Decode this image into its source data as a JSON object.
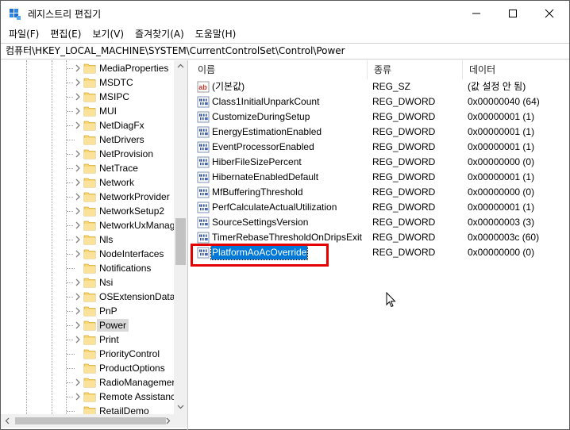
{
  "window": {
    "title": "레지스트리 편집기",
    "minimize_icon": "minimize-icon",
    "maximize_icon": "maximize-icon",
    "close_icon": "close-icon"
  },
  "menu": [
    "파일(F)",
    "편집(E)",
    "보기(V)",
    "즐겨찾기(A)",
    "도움말(H)"
  ],
  "address": "컴퓨터\\HKEY_LOCAL_MACHINE\\SYSTEM\\CurrentControlSet\\Control\\Power",
  "tree": {
    "items": [
      {
        "label": "MediaProperties",
        "expandable": true
      },
      {
        "label": "MSDTC",
        "expandable": true
      },
      {
        "label": "MSIPC",
        "expandable": true
      },
      {
        "label": "MUI",
        "expandable": true
      },
      {
        "label": "NetDiagFx",
        "expandable": true
      },
      {
        "label": "NetDrivers",
        "expandable": false
      },
      {
        "label": "NetProvision",
        "expandable": true
      },
      {
        "label": "NetTrace",
        "expandable": true
      },
      {
        "label": "Network",
        "expandable": true
      },
      {
        "label": "NetworkProvider",
        "expandable": true
      },
      {
        "label": "NetworkSetup2",
        "expandable": true
      },
      {
        "label": "NetworkUxManag",
        "expandable": true
      },
      {
        "label": "Nls",
        "expandable": true
      },
      {
        "label": "NodeInterfaces",
        "expandable": true
      },
      {
        "label": "Notifications",
        "expandable": false
      },
      {
        "label": "Nsi",
        "expandable": true
      },
      {
        "label": "OSExtensionData",
        "expandable": true
      },
      {
        "label": "PnP",
        "expandable": true
      },
      {
        "label": "Power",
        "expandable": true,
        "selected": true
      },
      {
        "label": "Print",
        "expandable": true
      },
      {
        "label": "PriorityControl",
        "expandable": false
      },
      {
        "label": "ProductOptions",
        "expandable": false
      },
      {
        "label": "RadioManagemer",
        "expandable": true
      },
      {
        "label": "Remote Assistanc",
        "expandable": true
      },
      {
        "label": "RetailDemo",
        "expandable": false
      }
    ]
  },
  "list": {
    "columns": [
      "이름",
      "종류",
      "데이터"
    ],
    "rows": [
      {
        "name": "(기본값)",
        "type": "REG_SZ",
        "data": "(값 설정 안 됨)",
        "icon": "string-value-icon"
      },
      {
        "name": "Class1InitialUnparkCount",
        "type": "REG_DWORD",
        "data": "0x00000040 (64)",
        "icon": "binary-value-icon"
      },
      {
        "name": "CustomizeDuringSetup",
        "type": "REG_DWORD",
        "data": "0x00000001 (1)",
        "icon": "binary-value-icon"
      },
      {
        "name": "EnergyEstimationEnabled",
        "type": "REG_DWORD",
        "data": "0x00000001 (1)",
        "icon": "binary-value-icon"
      },
      {
        "name": "EventProcessorEnabled",
        "type": "REG_DWORD",
        "data": "0x00000001 (1)",
        "icon": "binary-value-icon"
      },
      {
        "name": "HiberFileSizePercent",
        "type": "REG_DWORD",
        "data": "0x00000000 (0)",
        "icon": "binary-value-icon"
      },
      {
        "name": "HibernateEnabledDefault",
        "type": "REG_DWORD",
        "data": "0x00000001 (1)",
        "icon": "binary-value-icon"
      },
      {
        "name": "MfBufferingThreshold",
        "type": "REG_DWORD",
        "data": "0x00000000 (0)",
        "icon": "binary-value-icon"
      },
      {
        "name": "PerfCalculateActualUtilization",
        "type": "REG_DWORD",
        "data": "0x00000001 (1)",
        "icon": "binary-value-icon"
      },
      {
        "name": "SourceSettingsVersion",
        "type": "REG_DWORD",
        "data": "0x00000003 (3)",
        "icon": "binary-value-icon"
      },
      {
        "name": "TimerRebaseThresholdOnDripsExit",
        "type": "REG_DWORD",
        "data": "0x0000003c (60)",
        "icon": "binary-value-icon"
      },
      {
        "name": "PlatformAoAcOverride",
        "type": "REG_DWORD",
        "data": "0x00000000 (0)",
        "icon": "binary-value-icon",
        "selected": true
      }
    ]
  },
  "annotation": {
    "color": "#e50000",
    "target": "PlatformAoAcOverride"
  },
  "colors": {
    "selection": "#0078d7",
    "folder": "#f8d775"
  }
}
